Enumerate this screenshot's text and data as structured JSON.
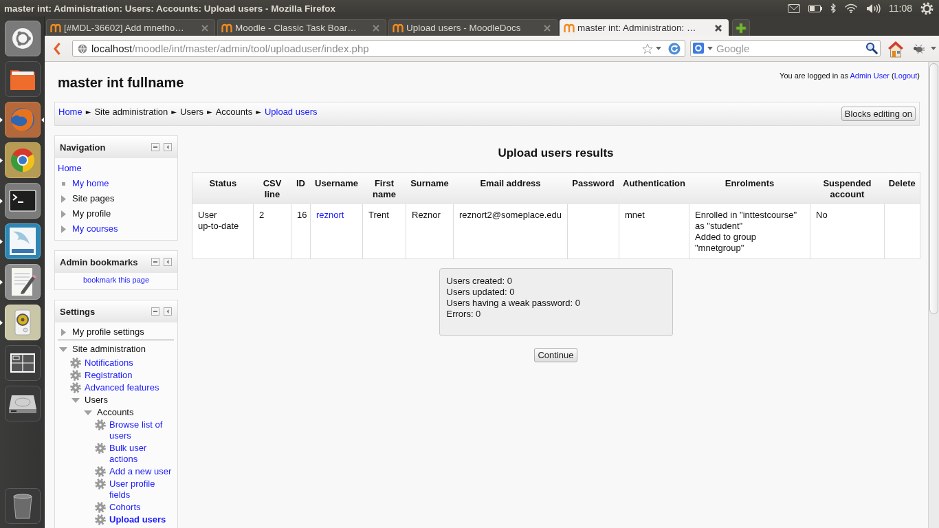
{
  "top_panel": {
    "window_title": "master int: Administration: Users: Accounts: Upload users - Mozilla Firefox",
    "clock": "11:08"
  },
  "launcher": {
    "items": [
      {
        "running": false,
        "focused": false
      },
      {
        "running": false,
        "focused": false
      },
      {
        "running": true,
        "focused": true
      },
      {
        "running": true,
        "focused": false
      },
      {
        "running": true,
        "focused": false
      },
      {
        "running": true,
        "focused": false
      },
      {
        "running": true,
        "focused": false
      },
      {
        "running": true,
        "focused": false
      },
      {
        "running": false,
        "focused": false
      },
      {
        "running": false,
        "focused": false
      }
    ]
  },
  "browser": {
    "tabs": [
      {
        "title": "[#MDL-36602] Add mnetho…",
        "selected": false
      },
      {
        "title": "Moodle - Classic Task Boar…",
        "selected": false
      },
      {
        "title": "Upload users - MoodleDocs",
        "selected": false
      },
      {
        "title": "master int: Administration: …",
        "selected": true
      }
    ],
    "url": {
      "host": "localhost",
      "path": "/moodle/int/master/admin/tool/uploaduser/index.php"
    },
    "search": {
      "placeholder": "Google"
    }
  },
  "page": {
    "login": {
      "parts": [
        {
          "kind": "text",
          "text": "You are logged in as "
        },
        {
          "kind": "link",
          "text": "Admin User"
        },
        {
          "kind": "text",
          "text": " ("
        },
        {
          "kind": "link",
          "text": "Logout"
        },
        {
          "kind": "text",
          "text": ")"
        }
      ]
    },
    "site_title": "master int fullname",
    "breadcrumb": {
      "items": [
        {
          "kind": "link",
          "text": "Home"
        },
        {
          "kind": "separator",
          "text": "►"
        },
        {
          "kind": "text",
          "text": "Site administration"
        },
        {
          "kind": "separator",
          "text": "►"
        },
        {
          "kind": "text",
          "text": "Users"
        },
        {
          "kind": "separator",
          "text": "►"
        },
        {
          "kind": "text",
          "text": "Accounts"
        },
        {
          "kind": "separator",
          "text": "►"
        },
        {
          "kind": "link",
          "text": "Upload users"
        }
      ],
      "button": "Blocks editing on"
    },
    "blocks": [
      {
        "kind": "navigation",
        "title": "Navigation",
        "nodes": [
          {
            "kind": "root",
            "text": "Home",
            "link": true,
            "selected": false,
            "children": [
              {
                "kind": "leaf",
                "text": "My home",
                "link": true,
                "selected": false
              },
              {
                "kind": "branch",
                "text": "Site pages",
                "link": false,
                "selected": false,
                "expanded": false
              },
              {
                "kind": "branch",
                "text": "My profile",
                "link": false,
                "selected": false,
                "expanded": false
              },
              {
                "kind": "branch",
                "text": "My courses",
                "link": true,
                "selected": false,
                "expanded": false
              }
            ]
          }
        ]
      },
      {
        "kind": "bookmarks",
        "title": "Admin bookmarks",
        "links": [
          "bookmark this page"
        ]
      },
      {
        "kind": "settings",
        "title": "Settings",
        "nodes": [
          {
            "kind": "branch",
            "text": "My profile settings",
            "link": false,
            "selected": false,
            "expanded": false
          },
          {
            "kind": "branch",
            "text": "Site administration",
            "link": false,
            "selected": false,
            "expanded": true,
            "children": [
              {
                "kind": "setting",
                "text": "Notifications",
                "link": true,
                "selected": false
              },
              {
                "kind": "setting",
                "text": "Registration",
                "link": true,
                "selected": false
              },
              {
                "kind": "setting",
                "text": "Advanced features",
                "link": true,
                "selected": false
              },
              {
                "kind": "branch",
                "text": "Users",
                "link": false,
                "selected": false,
                "expanded": true,
                "children": [
                  {
                    "kind": "branch",
                    "text": "Accounts",
                    "link": false,
                    "selected": false,
                    "expanded": true,
                    "children": [
                      {
                        "kind": "setting",
                        "text": "Browse list of users",
                        "link": true,
                        "selected": false
                      },
                      {
                        "kind": "setting",
                        "text": "Bulk user actions",
                        "link": true,
                        "selected": false
                      },
                      {
                        "kind": "setting",
                        "text": "Add a new user",
                        "link": true,
                        "selected": false
                      },
                      {
                        "kind": "setting",
                        "text": "User profile fields",
                        "link": true,
                        "selected": false
                      },
                      {
                        "kind": "setting",
                        "text": "Cohorts",
                        "link": true,
                        "selected": false
                      },
                      {
                        "kind": "setting",
                        "text": "Upload users",
                        "link": true,
                        "selected": true
                      }
                    ]
                  }
                ]
              }
            ]
          }
        ]
      }
    ],
    "results": {
      "heading": "Upload users results",
      "table": {
        "columns": [
          "Status",
          "CSV line",
          "ID",
          "Username",
          "First name",
          "Surname",
          "Email address",
          "Password",
          "Authentication",
          "Enrolments",
          "Suspended account",
          "Delete"
        ],
        "rows": [
          {
            "cells": [
              {
                "kind": "text",
                "text": "User up-to-date"
              },
              {
                "kind": "text",
                "text": "2"
              },
              {
                "kind": "text",
                "text": "16"
              },
              {
                "kind": "link",
                "text": "reznort"
              },
              {
                "kind": "text",
                "text": "Trent"
              },
              {
                "kind": "text",
                "text": "Reznor"
              },
              {
                "kind": "text",
                "text": "reznort2@someplace.edu"
              },
              {},
              {
                "kind": "text",
                "text": "mnet"
              },
              {
                "kind": "lines",
                "lines": [
                  "Enrolled in \"inttestcourse\" as \"student\"",
                  "Added to group \"mnetgroup\""
                ]
              },
              {
                "kind": "text",
                "text": "No"
              },
              {}
            ]
          }
        ]
      },
      "summary": [
        "Users created: 0",
        "Users updated: 0",
        "Users having a weak password: 0",
        "Errors: 0"
      ],
      "continue_button": "Continue"
    }
  }
}
